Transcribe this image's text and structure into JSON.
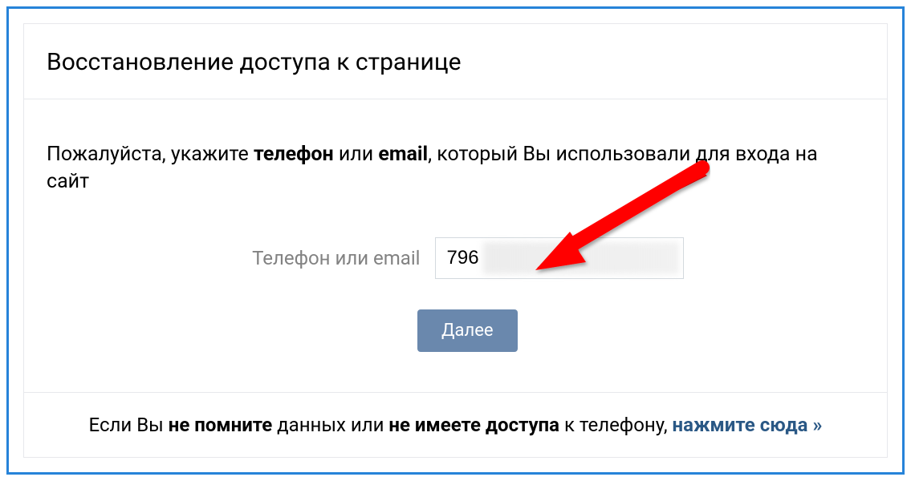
{
  "header": {
    "title": "Восстановление доступа к странице"
  },
  "content": {
    "instruction_prefix": "Пожалуйста, укажите ",
    "instruction_bold1": "телефон",
    "instruction_mid": " или ",
    "instruction_bold2": "email",
    "instruction_suffix": ", который Вы использовали для входа на сайт",
    "field_label": "Телефон или email",
    "input_value": "796",
    "button_label": "Далее"
  },
  "footer": {
    "text_prefix": "Если Вы ",
    "text_bold1": "не помните",
    "text_mid1": " данных или ",
    "text_bold2": "не имеете доступа",
    "text_mid2": " к телефону, ",
    "link_text": "нажмите сюда »"
  },
  "colors": {
    "frame_border": "#2683d9",
    "panel_border": "#e7e8ec",
    "button_bg": "#6a88ad",
    "link_color": "#2a5885",
    "arrow_color": "#ff0000"
  }
}
